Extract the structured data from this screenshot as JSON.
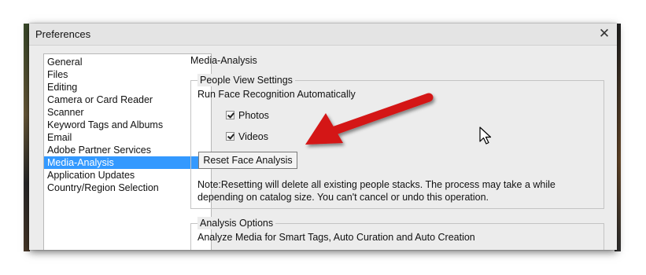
{
  "window": {
    "title": "Preferences",
    "close_label": "✕"
  },
  "sidebar": {
    "items": [
      {
        "label": "General"
      },
      {
        "label": "Files"
      },
      {
        "label": "Editing"
      },
      {
        "label": "Camera or Card Reader"
      },
      {
        "label": "Scanner"
      },
      {
        "label": "Keyword Tags and Albums"
      },
      {
        "label": "Email"
      },
      {
        "label": "Adobe Partner Services"
      },
      {
        "label": "Media-Analysis",
        "selected": true
      },
      {
        "label": "Application Updates"
      },
      {
        "label": "Country/Region Selection"
      }
    ]
  },
  "main": {
    "section_title": "Media-Analysis",
    "people_view": {
      "legend": "People View Settings",
      "run_label": "Run Face Recognition Automatically",
      "photos": {
        "label": "Photos",
        "checked": true
      },
      "videos": {
        "label": "Videos",
        "checked": true
      },
      "reset_button": "Reset Face Analysis",
      "note_line1": "Note:Resetting will delete all existing people stacks. The process may take a while",
      "note_line2": "depending on catalog size. You can't cancel or undo this operation."
    },
    "analysis_options": {
      "legend": "Analysis Options",
      "description": "Analyze Media for Smart Tags, Auto Curation and Auto Creation"
    }
  },
  "colors": {
    "selection": "#3399ff",
    "annotation_arrow": "#d41414",
    "dialog_bg": "#ececec"
  }
}
